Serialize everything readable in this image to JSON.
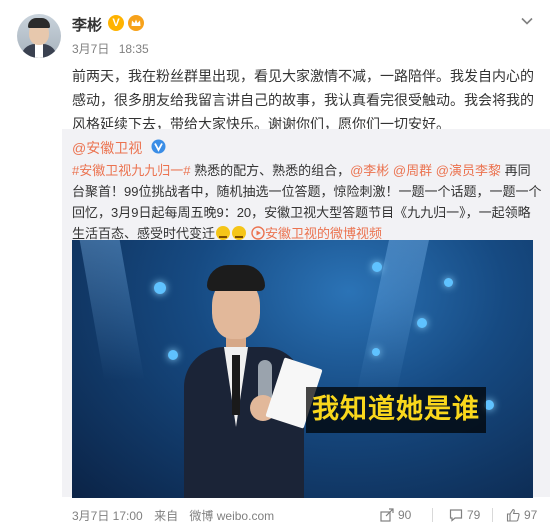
{
  "author": {
    "name": "李彬",
    "vip_label": "V",
    "date": "3月7日",
    "time": "18:35"
  },
  "post_text": "前两天，我在粉丝群里出现，看见大家激情不减，一路陪伴。我发自内心的感动，很多朋友给我留言讲自己的故事，我认真看完很受触动。我会将我的风格延续下去，带给大家快乐。谢谢你们，愿你们一切安好。",
  "repost": {
    "author": "@安徽卫视",
    "segments": [
      {
        "t": "#安徽卫视九九归一#",
        "hl": true
      },
      {
        "t": " 熟悉的配方、熟悉的组合，",
        "hl": false
      },
      {
        "t": "@李彬",
        "hl": true
      },
      {
        "t": " ",
        "hl": false
      },
      {
        "t": "@周群",
        "hl": true
      },
      {
        "t": " ",
        "hl": false
      },
      {
        "t": "@演员李黎",
        "hl": true
      },
      {
        "t": " 再同台聚首！99位挑战者中，随机抽选一位答题，惊险刺激！一题一个话题，一题一个回忆，3月9日起每周五晚9：20，安徽卫视大型答题节目《九九归一》，一起领略生活百态、感受时代变迁",
        "hl": false
      }
    ],
    "video_link": "安徽卫视的微博视频",
    "video_caption": "我知道她是谁"
  },
  "footer": {
    "date": "3月7日 17:00",
    "source_prefix": "来自",
    "source": "微博 weibo.com",
    "share_count": "90",
    "comment_count": "79",
    "like_count": "97"
  },
  "colors": {
    "highlight": "#eb7350",
    "repost_bg": "#f2f2f5",
    "caption_text": "#f9d71c"
  }
}
